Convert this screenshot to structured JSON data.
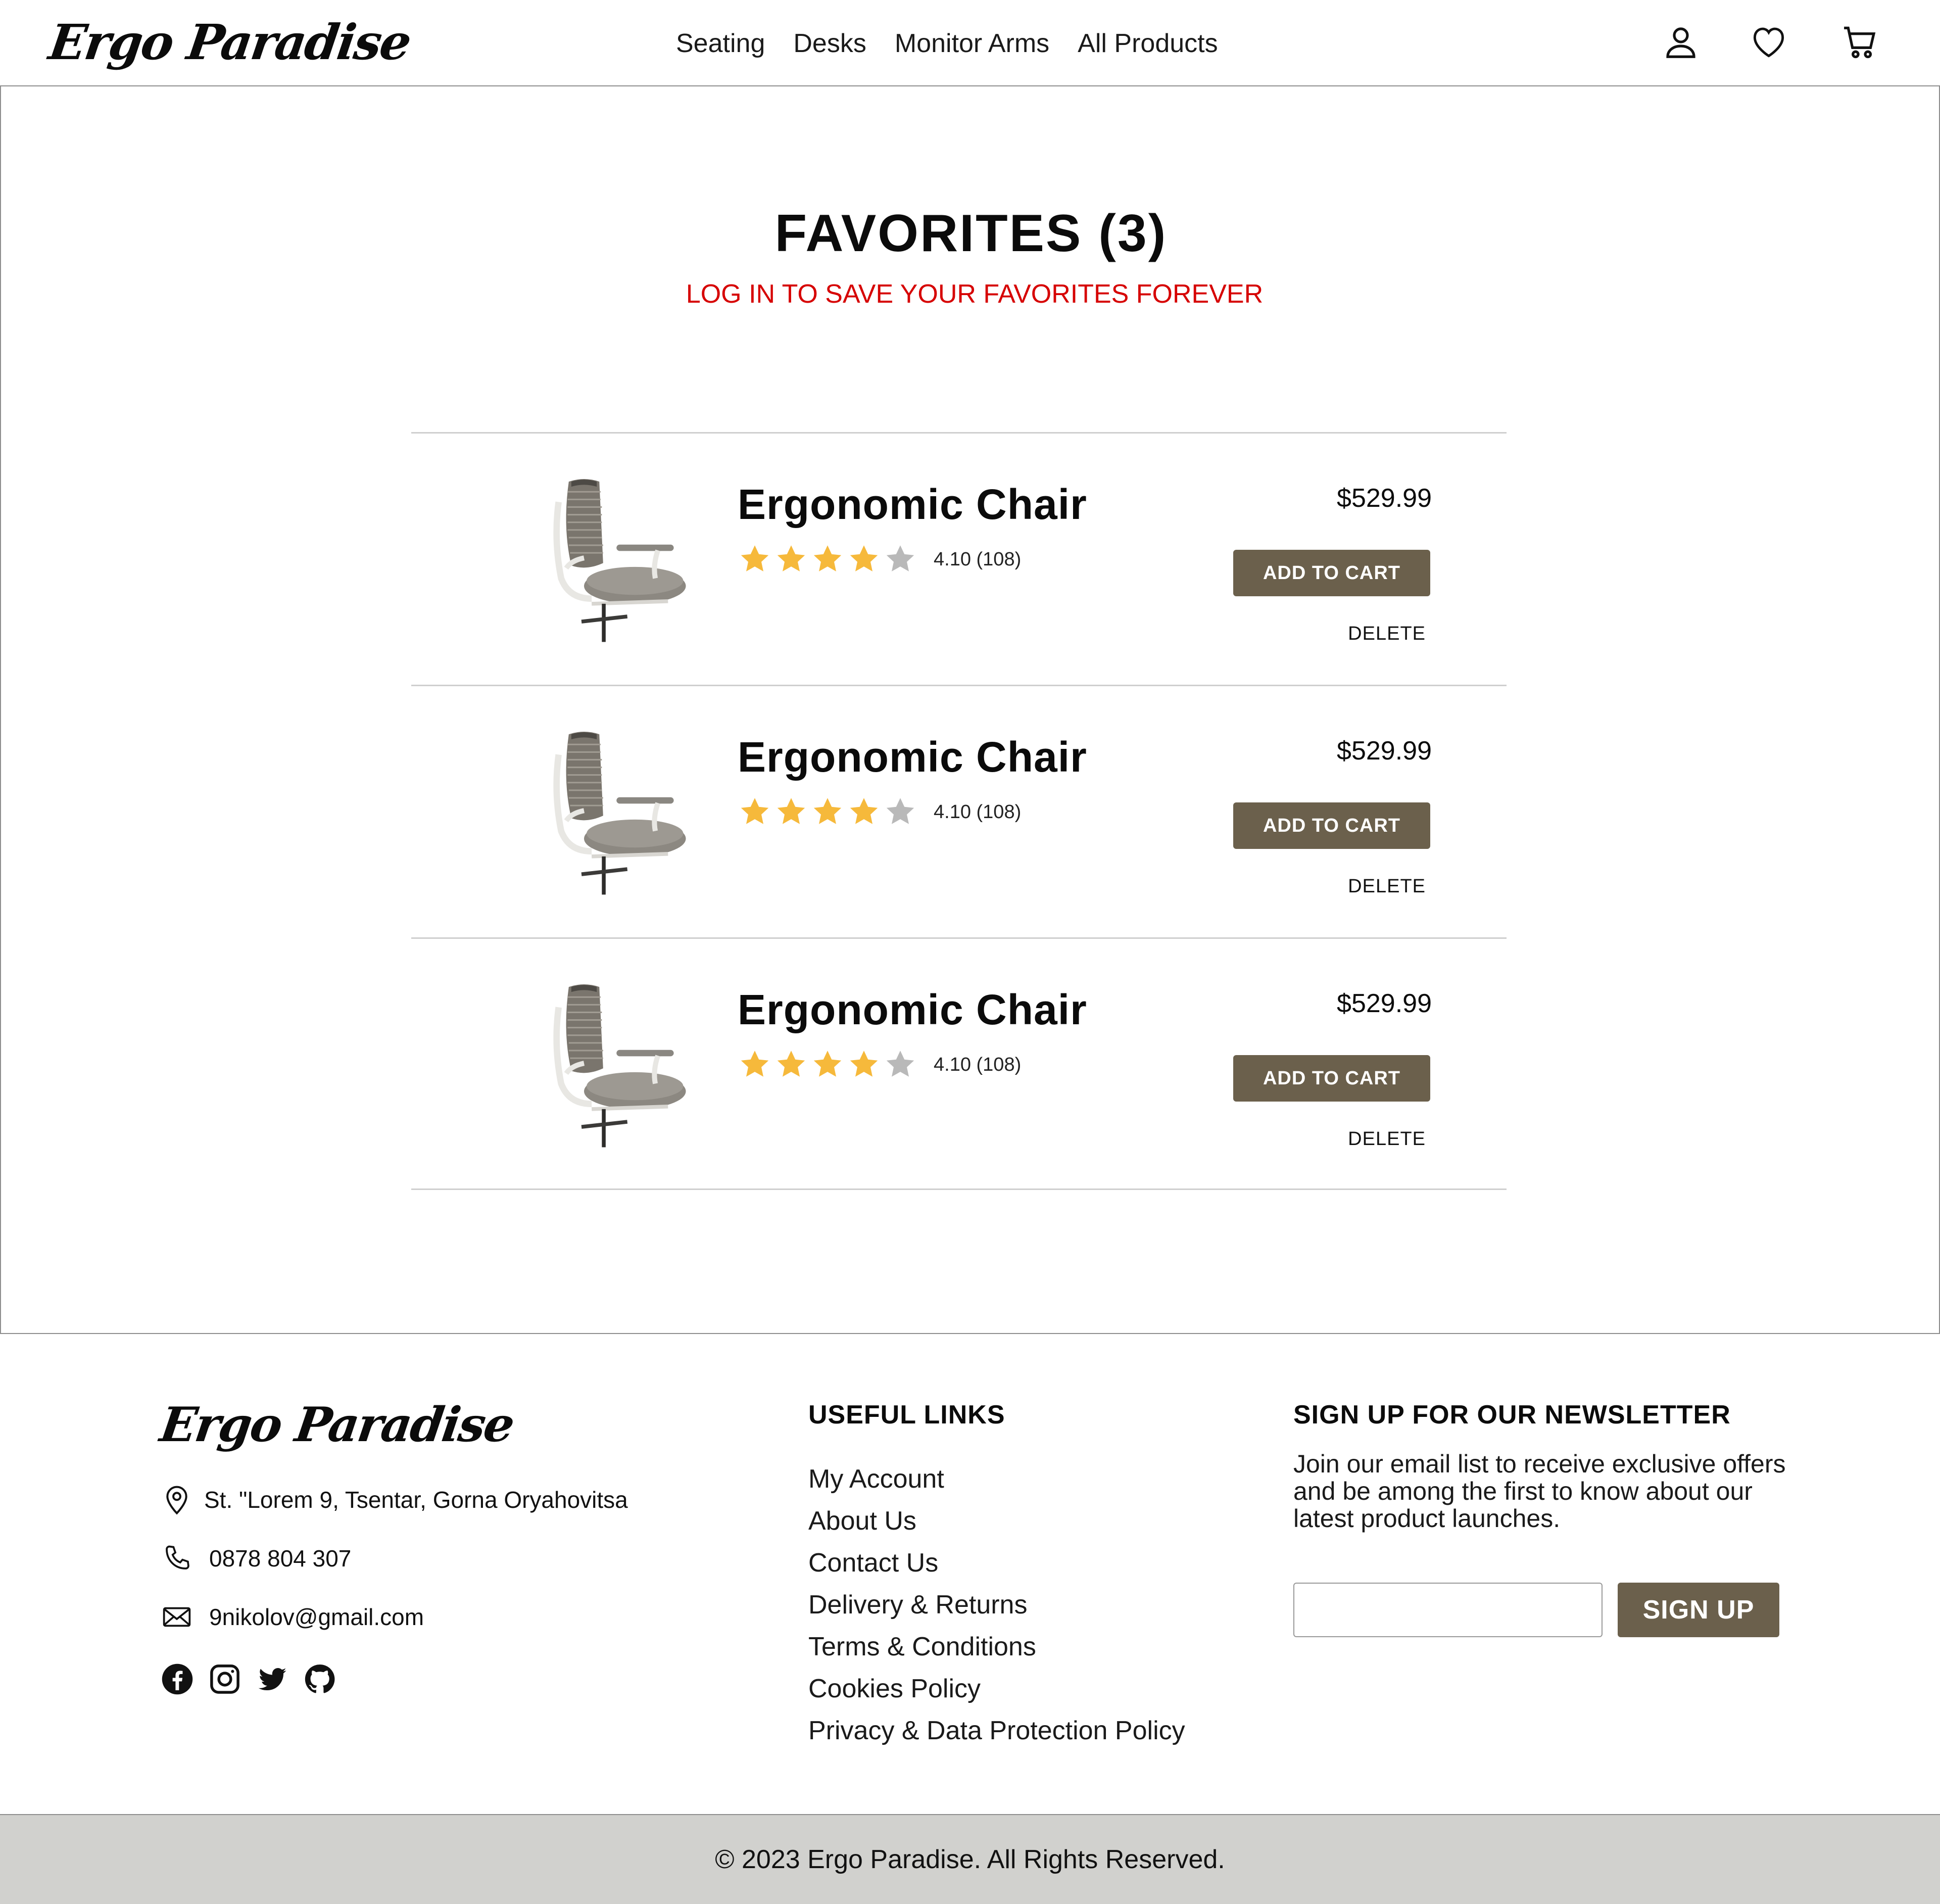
{
  "brand": {
    "logo_text": "Ergo Paradise"
  },
  "nav": {
    "links": [
      "Seating",
      "Desks",
      "Monitor Arms",
      "All Products"
    ]
  },
  "header_icons": [
    "user-icon",
    "heart-icon",
    "cart-icon"
  ],
  "favorites": {
    "title": "FAVORITES (3)",
    "login_note": "LOG IN TO SAVE YOUR FAVORITES FOREVER",
    "items": [
      {
        "name": "Ergonomic Chair",
        "rating": 4.1,
        "rating_text": "4.10 (108)",
        "stars_filled": 4,
        "stars_total": 5,
        "price": "$529.99",
        "add_label": "ADD TO CART",
        "delete_label": "DELETE"
      },
      {
        "name": "Ergonomic Chair",
        "rating": 4.1,
        "rating_text": "4.10 (108)",
        "stars_filled": 4,
        "stars_total": 5,
        "price": "$529.99",
        "add_label": "ADD TO CART",
        "delete_label": "DELETE"
      },
      {
        "name": "Ergonomic Chair",
        "rating": 4.1,
        "rating_text": "4.10 (108)",
        "stars_filled": 4,
        "stars_total": 5,
        "price": "$529.99",
        "add_label": "ADD TO CART",
        "delete_label": "DELETE"
      }
    ]
  },
  "footer": {
    "logo_text": "Ergo Paradise",
    "address": "St. \"Lorem 9, Tsentar, Gorna Oryahovitsa",
    "phone": "0878 804 307",
    "email": "9nikolov@gmail.com",
    "socials": [
      "facebook-icon",
      "instagram-icon",
      "twitter-icon",
      "github-icon"
    ],
    "useful_links_title": "USEFUL LINKS",
    "useful_links": [
      "My Account",
      "About Us",
      "Contact Us",
      "Delivery & Returns",
      "Terms & Conditions",
      "Cookies Policy",
      "Privacy & Data Protection Policy"
    ],
    "newsletter_title": "SIGN UP FOR OUR NEWSLETTER",
    "newsletter_text": "Join our email list to receive exclusive offers and be among the first to know about our latest product launches.",
    "newsletter_input_value": "",
    "newsletter_button": "SIGN UP",
    "copyright": "© 2023 Ergo Paradise. All Rights Reserved."
  },
  "colors": {
    "accent": "#6b604c",
    "login_note": "#d60000",
    "star_filled": "#f6b93b",
    "star_empty": "#b9b9b9",
    "copyright_bar": "#d1d1ce"
  }
}
